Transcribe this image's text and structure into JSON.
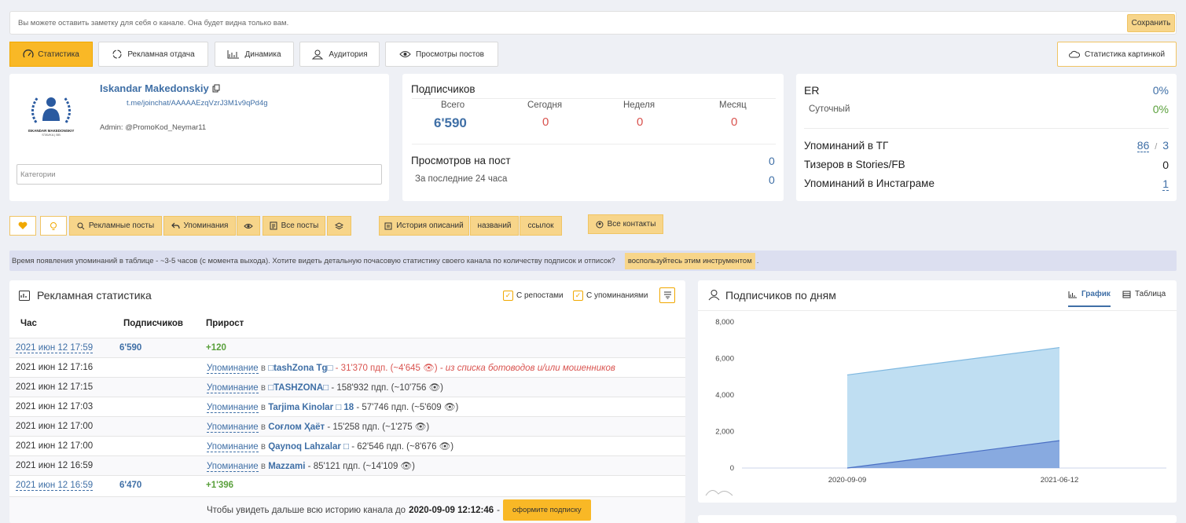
{
  "note": {
    "placeholder": "Вы можете оставить заметку для себя о канале. Она будет видна только вам.",
    "save": "Сохранить"
  },
  "tabs": [
    "Статистика",
    "Рекламная отдача",
    "Динамика",
    "Аудитория",
    "Просмотры постов"
  ],
  "image_stats": "Статистика картинкой",
  "channel": {
    "name": "Iskandar Makedonskiy",
    "link": "t.me/joinchat/AAAAAEzqVzrJ3M1v9qPd4g",
    "admin_label": "Admin:",
    "admin": "@PromoKod_Neymar11",
    "logo_text": "ISKANDAR MAKEDONSKIY",
    "logo_sub": "STAVKA | ВВ",
    "categories_placeholder": "Категории"
  },
  "subs": {
    "title": "Подписчиков",
    "total_label": "Всего",
    "total": "6'590",
    "today_label": "Сегодня",
    "today": "0",
    "week_label": "Неделя",
    "week": "0",
    "month_label": "Месяц",
    "month": "0",
    "views_title": "Просмотров на пост",
    "views": "0",
    "last24_label": "За последние 24 часа",
    "last24": "0"
  },
  "er": {
    "er_label": "ER",
    "er": "0%",
    "daily_label": "Суточный",
    "daily": "0%",
    "mentions_label": "Упоминаний в ТГ",
    "mentions_a": "86",
    "mentions_sep": "/",
    "mentions_b": "3",
    "teasers_label": "Тизеров в Stories/FB",
    "teasers": "0",
    "insta_label": "Упоминаний в Инстаграме",
    "insta": "1"
  },
  "actions": {
    "ad_posts": "Рекламные посты",
    "mentions": "Упоминания",
    "all_posts": "Все посты",
    "history": "История описаний",
    "names": "названий",
    "links": "ссылок",
    "contacts": "Все контакты"
  },
  "info": {
    "text": "Время появления упоминаний в таблице - ~3-5 часов (с момента выхода). Хотите видеть детальную почасовую статистику своего канала по количеству подписок и отписок?",
    "btn": "воспользуйтесь этим инструментом",
    "tail": "."
  },
  "ad_stats": {
    "title": "Рекламная статистика",
    "reposts": "С репостами",
    "with_mentions": "С упоминаниями",
    "headers": [
      "Час",
      "Подписчиков",
      "Прирост"
    ],
    "mention_word": "Упоминание",
    "in_word": "в",
    "rows": [
      {
        "time": "2021 июн 12 17:59",
        "subs": "6'590",
        "growth": "+120"
      },
      {
        "time": "2021 июн 12 17:16",
        "channel": "□tashZona Tg□",
        "info": " - 31'370 пдп. (~4'645 👁)",
        "warn": " - из списка ботоводов и/или мошенников"
      },
      {
        "time": "2021 июн 12 17:15",
        "channel": "□TASHZONA□",
        "info": " - 158'932 пдп. (~10'756 👁)"
      },
      {
        "time": "2021 июн 12 17:03",
        "channel": "Tarjima Kinolar □ 18",
        "info": " - 57'746 пдп. (~5'609 👁)"
      },
      {
        "time": "2021 июн 12 17:00",
        "channel": "Соғлом Ҳаёт",
        "info": " - 15'258 пдп. (~1'275 👁)"
      },
      {
        "time": "2021 июн 12 17:00",
        "channel": "Qaynoq Lahzalar □",
        "info": " - 62'546 пдп. (~8'676 👁)"
      },
      {
        "time": "2021 июн 12 16:59",
        "channel": "Mazzami",
        "info": " - 85'121 пдп. (~14'109 👁)"
      },
      {
        "time": "2021 июн 12 16:59",
        "subs": "6'470",
        "growth": "+1'396"
      }
    ],
    "footer_text": "Чтобы увидеть дальше всю историю канала до",
    "footer_date": "2020-09-09 12:12:46",
    "footer_dash": "-",
    "footer_btn": "оформите подписку"
  },
  "subs_chart": {
    "title": "Подписчиков по дням",
    "tab_chart": "График",
    "tab_table": "Таблица"
  },
  "chart_data": {
    "type": "area",
    "title": "Подписчиков по дням",
    "x": [
      "2020-09-09",
      "2021-06-12"
    ],
    "yticks": [
      "8,000",
      "6,000",
      "4,000",
      "2,000",
      "0"
    ],
    "ylim": [
      0,
      8000
    ],
    "series": [
      {
        "values": [
          5100,
          6600
        ],
        "color": "#a9d3ee"
      },
      {
        "values": [
          0,
          1500
        ],
        "color": "#5b7fd1"
      }
    ]
  }
}
